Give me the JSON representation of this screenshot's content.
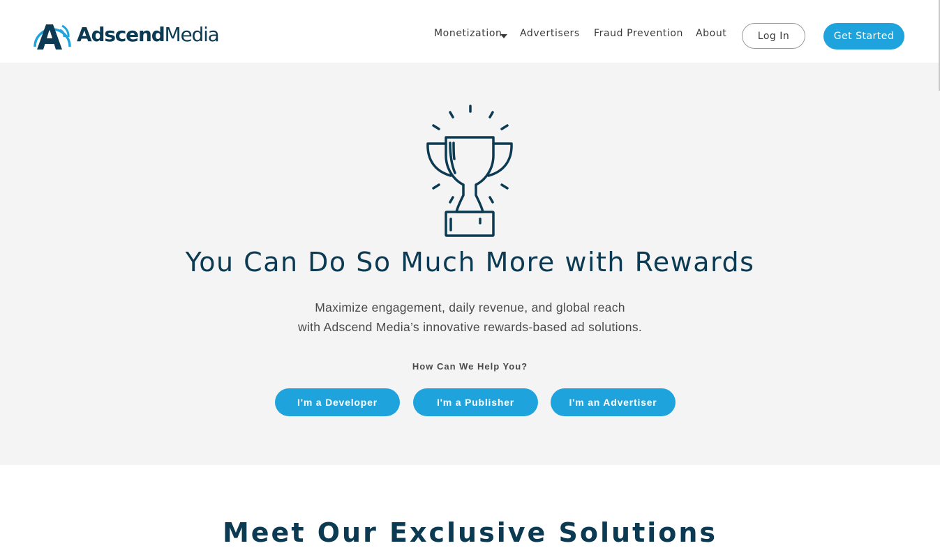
{
  "header": {
    "logo_text_bold": "Adscend",
    "logo_text_light": "Media",
    "nav": [
      {
        "label": "Monetization",
        "has_dropdown": true
      },
      {
        "label": "Advertisers"
      },
      {
        "label": "Fraud Prevention"
      },
      {
        "label": "About"
      }
    ],
    "login_label": "Log In",
    "get_started_label": "Get Started"
  },
  "hero": {
    "icon": "trophy-icon",
    "title": "You Can Do So Much More with Rewards",
    "subtitle_line1": "Maximize engagement, daily revenue, and global reach",
    "subtitle_line2": "with Adscend Media’s innovative rewards-based ad solutions.",
    "help_prompt": "How Can We Help You?",
    "buttons": [
      {
        "label": "I'm a Developer"
      },
      {
        "label": "I'm a Publisher"
      },
      {
        "label": "I'm an Advertiser"
      }
    ]
  },
  "solutions": {
    "title": "Meet Our Exclusive Solutions"
  },
  "colors": {
    "accent": "#1ea3dc",
    "navy": "#0b3a52",
    "hero_bg": "#f4f4f4"
  }
}
